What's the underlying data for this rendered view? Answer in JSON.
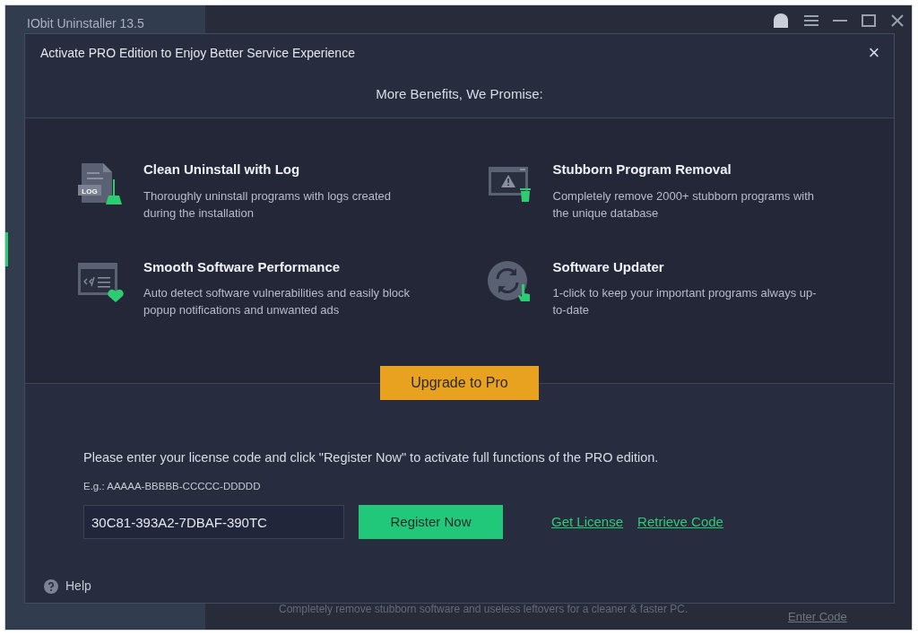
{
  "app": {
    "title": "IObit Uninstaller 13.5",
    "footer_text": "Completely remove stubborn software and useless leftovers for a cleaner & faster PC.",
    "footer_link": "Enter Code"
  },
  "dialog": {
    "title": "Activate PRO Edition to Enjoy Better Service Experience",
    "close": "×",
    "heading": "More Benefits, We Promise:",
    "features": [
      {
        "kind": "log",
        "title": "Clean Uninstall with Log",
        "description": "Thoroughly uninstall programs with logs created during the installation",
        "icon_label": "LOG"
      },
      {
        "kind": "removal",
        "title": "Stubborn Program Removal",
        "description": "Completely remove 2000+ stubborn programs with the unique database"
      },
      {
        "kind": "performance",
        "title": "Smooth Software Performance",
        "description": "Auto detect software vulnerabilities and easily block popup notifications and unwanted ads"
      },
      {
        "kind": "updater",
        "title": "Software Updater",
        "description": "1-click to keep your important programs always up-to-date"
      }
    ],
    "upgrade_button": "Upgrade to Pro",
    "instructions": "Please enter your license code and click \"Register Now\" to activate full functions of the PRO edition.",
    "example": "E.g.: AAAAA-BBBBB-CCCCC-DDDDD",
    "license_field": {
      "value": "30C81-393A2-7DBAF-390TC"
    },
    "register_button": "Register Now",
    "links": [
      "Get License",
      "Retrieve Code"
    ],
    "help": "Help"
  }
}
